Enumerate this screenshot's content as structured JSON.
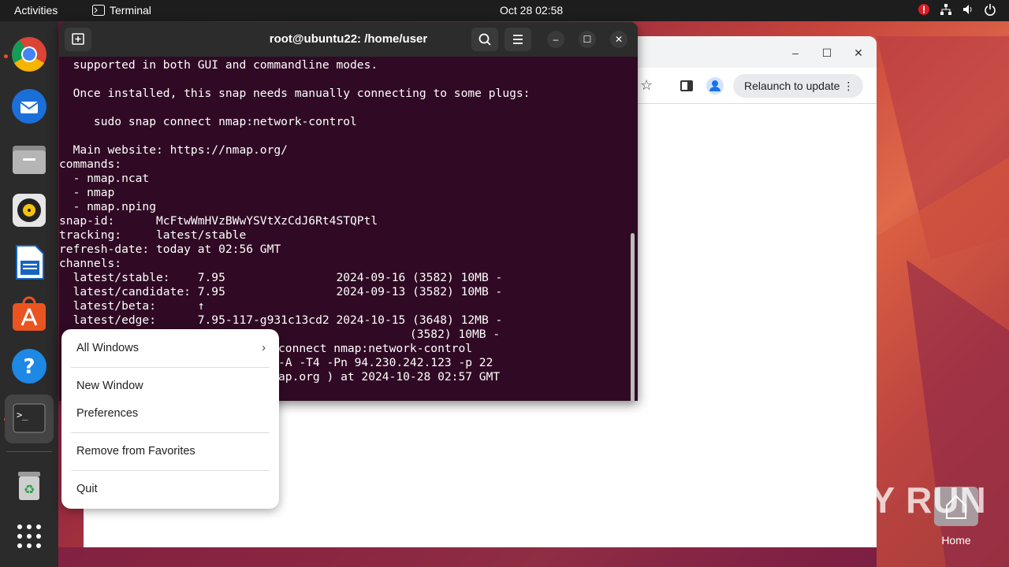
{
  "topbar": {
    "activities": "Activities",
    "app_name": "Terminal",
    "clock": "Oct 28  02:58"
  },
  "dock": {
    "items": [
      "Google Chrome",
      "Thunderbird Mail",
      "Files",
      "Rhythmbox",
      "LibreOffice Writer",
      "Ubuntu Software",
      "Help",
      "Terminal",
      "Trash",
      "Show Applications"
    ]
  },
  "chrome": {
    "relaunch_label": "Relaunch to update"
  },
  "terminal": {
    "title": "root@ubuntu22: /home/user",
    "lines": [
      "  supported in both GUI and commandline modes.",
      "",
      "  Once installed, this snap needs manually connecting to some plugs:",
      "",
      "     sudo snap connect nmap:network-control",
      "",
      "  Main website: https://nmap.org/",
      "commands:",
      "  - nmap.ncat",
      "  - nmap",
      "  - nmap.nping",
      "snap-id:      McFtwWmHVzBWwYSVtXzCdJ6Rt4STQPtl",
      "tracking:     latest/stable",
      "refresh-date: today at 02:56 GMT",
      "channels:",
      "  latest/stable:    7.95                2024-09-16 (3582) 10MB -",
      "  latest/candidate: 7.95                2024-09-13 (3582) 10MB -",
      "  latest/beta:      ↑",
      "  latest/edge:      7.95-117-g931c13cd2 2024-10-15 (3648) 12MB -"
    ],
    "partial_lines": [
      "                   (3582) 10MB -",
      "connect nmap:network-control",
      "-A -T4 -Pn 94.230.242.123 -p 22",
      "ap.org ) at 2024-10-28 02:57 GMT"
    ]
  },
  "context_menu": {
    "all_windows": "All Windows",
    "new_window": "New Window",
    "preferences": "Preferences",
    "remove_favorites": "Remove from Favorites",
    "quit": "Quit"
  },
  "desktop": {
    "home_label": "Home"
  },
  "watermark": "ANY RUN",
  "colors": {
    "terminal_bg": "#300a24",
    "topbar_bg": "#1d1d1d",
    "dock_bg": "#2b2b2b",
    "accent": "#e95420"
  }
}
